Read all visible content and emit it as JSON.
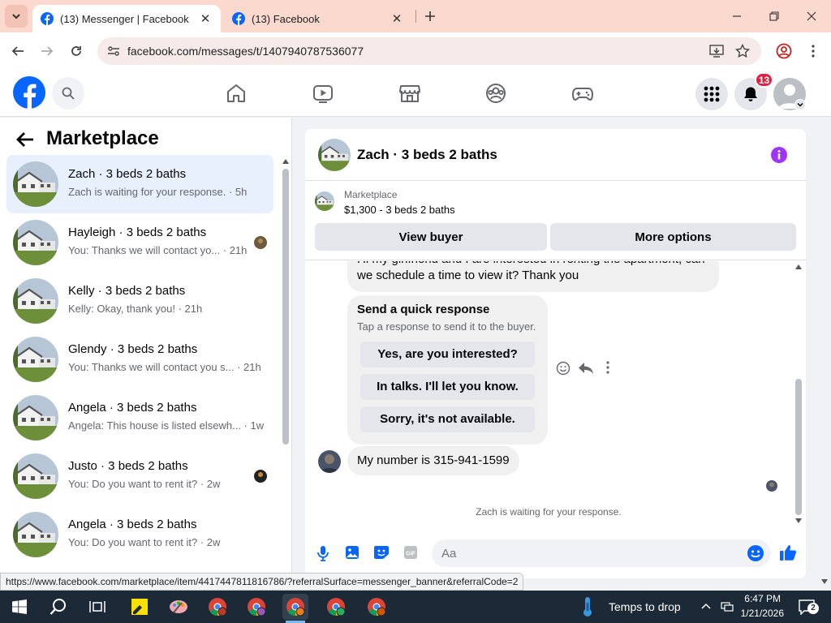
{
  "browser": {
    "tabs": [
      {
        "title": "(13) Messenger | Facebook",
        "active": true
      },
      {
        "title": "(13) Facebook",
        "active": false
      }
    ],
    "url": "facebook.com/messages/t/1407940787536077",
    "status_url": "https://www.facebook.com/marketplace/item/4417447811816786/?referralSurface=messenger_banner&referralCode=2"
  },
  "fb": {
    "notifications_count": "13",
    "nav_icons": [
      "home-icon",
      "watch-icon",
      "marketplace-icon",
      "groups-icon",
      "gaming-icon"
    ]
  },
  "left": {
    "title": "Marketplace",
    "conversations": [
      {
        "name": "Zach · 3 beds 2 baths",
        "preview": "Zach is waiting for your response. · 5h",
        "selected": true,
        "read_avatar": false
      },
      {
        "name": "Hayleigh · 3 beds 2 baths",
        "preview": "You: Thanks we will contact yo...  · 21h",
        "selected": false,
        "read_avatar": true
      },
      {
        "name": "Kelly · 3 beds 2 baths",
        "preview": "Kelly: Okay, thank you! · 21h",
        "selected": false,
        "read_avatar": false
      },
      {
        "name": "Glendy · 3 beds 2 baths",
        "preview": "You: Thanks we will contact you s...  · 21h",
        "selected": false,
        "read_avatar": false
      },
      {
        "name": "Angela · 3 beds 2 baths",
        "preview": "Angela: This house is listed elsewh...  · 1w",
        "selected": false,
        "read_avatar": false
      },
      {
        "name": "Justo · 3 beds 2 baths",
        "preview": "You: Do you want to rent it? · 2w",
        "selected": false,
        "read_avatar": true
      },
      {
        "name": "Angela · 3 beds 2 baths",
        "preview": "You: Do you want to rent it? · 2w",
        "selected": false,
        "read_avatar": false
      }
    ]
  },
  "chat": {
    "title": "Zach · 3 beds 2 baths",
    "banner": {
      "label": "Marketplace",
      "listing": "$1,300 - 3 beds 2 baths",
      "view_buyer": "View buyer",
      "more_options": "More options"
    },
    "messages": {
      "first_line1": "Hi my girlfriend and I are interested in renting the apartment, can",
      "first_line2": "we schedule a time to view it? Thank you",
      "quick_title": "Send a quick response",
      "quick_sub": "Tap a response to send it to the buyer.",
      "quick_options": [
        "Yes, are you interested?",
        "In talks. I'll let you know.",
        "Sorry, it's not available."
      ],
      "number_msg": "My number is 315-941-1599"
    },
    "waiting": "Zach is waiting for your response.",
    "input_placeholder": "Aa"
  },
  "taskbar": {
    "weather": "Temps to drop",
    "time": "6:47 PM",
    "date": "1/21/2026",
    "notif_count": "2"
  }
}
